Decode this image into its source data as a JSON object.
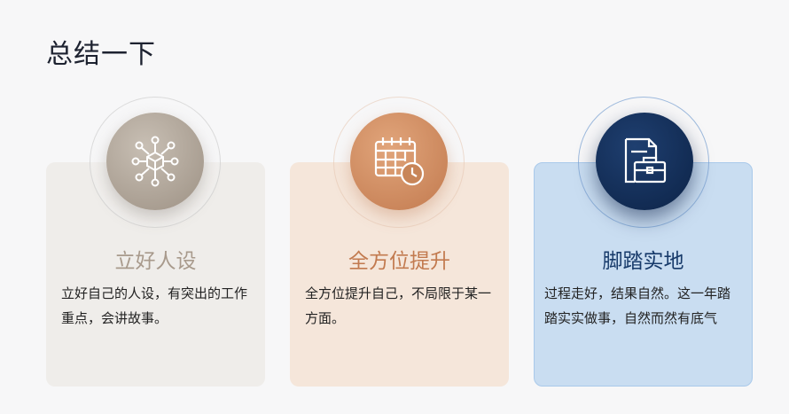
{
  "page": {
    "title": "总结一下"
  },
  "cards": [
    {
      "heading": "立好人设",
      "body": "立好自己的人设，有突出的工作重点，会讲故事。",
      "icon": "network-cube-icon",
      "color": "#a89a8c"
    },
    {
      "heading": "全方位提升",
      "body": "全方位提升自己，不局限于某一方面。",
      "icon": "calendar-clock-icon",
      "color": "#c27a4f"
    },
    {
      "heading": "脚踏实地",
      "body": "过程走好，结果自然。这一年踏踏实实做事，自然而然有底气",
      "icon": "briefcase-document-icon",
      "color": "#173a6a"
    }
  ]
}
